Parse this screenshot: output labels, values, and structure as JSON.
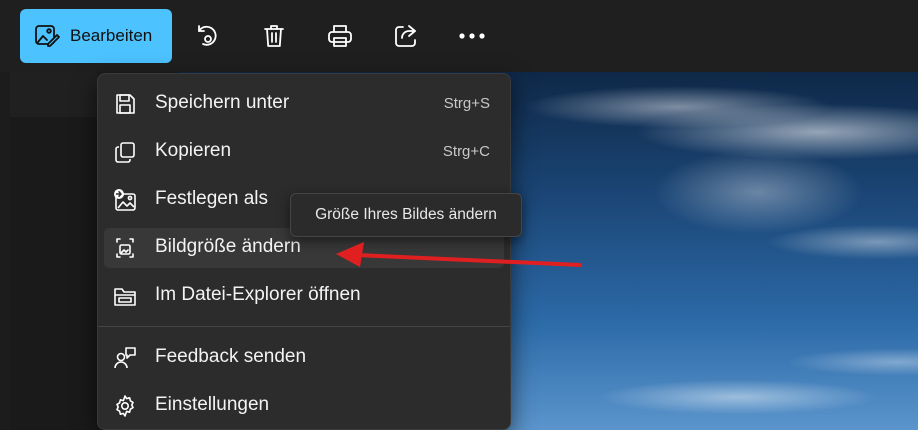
{
  "toolbar": {
    "edit_label": "Bearbeiten",
    "accent_color": "#4cc2ff",
    "icons": [
      "edit-image-icon",
      "rotate-icon",
      "delete-icon",
      "print-icon",
      "share-icon",
      "more-icon"
    ]
  },
  "menu": {
    "items": [
      {
        "label": "Speichern unter",
        "shortcut": "Strg+S",
        "icon": "save-icon"
      },
      {
        "label": "Kopieren",
        "shortcut": "Strg+C",
        "icon": "copy-icon"
      },
      {
        "label": "Festlegen als",
        "shortcut": "",
        "icon": "set-as-icon"
      },
      {
        "label": "Bildgröße ändern",
        "shortcut": "",
        "icon": "resize-icon"
      },
      {
        "label": "Im Datei-Explorer öffnen",
        "shortcut": "",
        "icon": "folder-icon"
      },
      {
        "label": "Feedback senden",
        "shortcut": "",
        "icon": "feedback-icon"
      },
      {
        "label": "Einstellungen",
        "shortcut": "",
        "icon": "gear-icon"
      }
    ]
  },
  "tooltip": {
    "text": "Größe Ihres Bildes ändern"
  },
  "annotation": {
    "arrow_color": "#e02020"
  }
}
